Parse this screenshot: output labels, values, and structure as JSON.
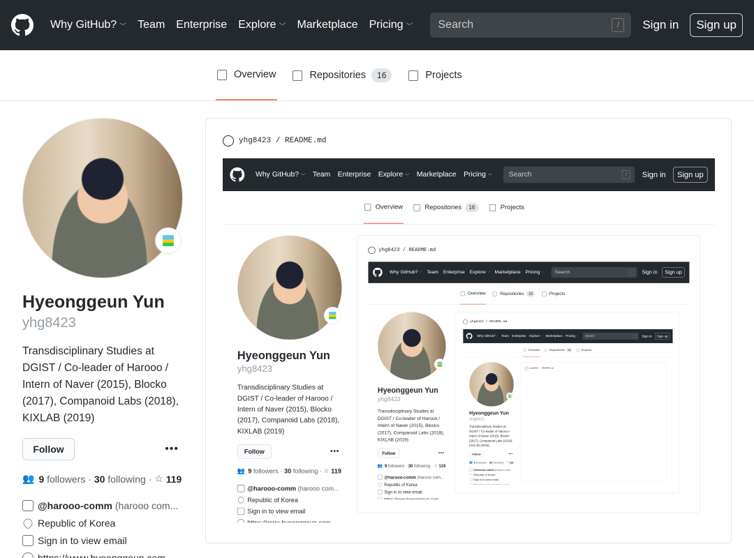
{
  "header": {
    "nav": [
      {
        "label": "Why GitHub?",
        "caret": true
      },
      {
        "label": "Team",
        "caret": false
      },
      {
        "label": "Enterprise",
        "caret": false
      },
      {
        "label": "Explore",
        "caret": true
      },
      {
        "label": "Marketplace",
        "caret": false
      },
      {
        "label": "Pricing",
        "caret": true
      }
    ],
    "search_placeholder": "Search",
    "search_hotkey": "/",
    "signin": "Sign in",
    "signup": "Sign up"
  },
  "tabs": {
    "overview": "Overview",
    "repositories": "Repositories",
    "repositories_count": "16",
    "projects": "Projects"
  },
  "profile": {
    "name": "Hyeonggeun Yun",
    "login": "yhg8423",
    "bio": "Transdisciplinary Studies at DGIST / Co-leader of Harooo / Intern of Naver (2015), Blocko (2017), Companoid Labs (2018), KIXLAB (2019)",
    "follow": "Follow",
    "more": "•••",
    "followers": "9",
    "followers_label": "followers",
    "sep": "·",
    "following": "30",
    "following_label": "following",
    "stars": "119",
    "org": "@harooo-comm",
    "org_sub": "(harooo com...",
    "location": "Republic of Korea",
    "email": "Sign in to view email",
    "website": "https://www.hyeonggeun.com"
  },
  "readme": {
    "user": "yhg8423",
    "slash": "/",
    "file": "README.md"
  },
  "colors": {
    "header_bg": "#24292e",
    "active_tab": "#f9826c"
  }
}
